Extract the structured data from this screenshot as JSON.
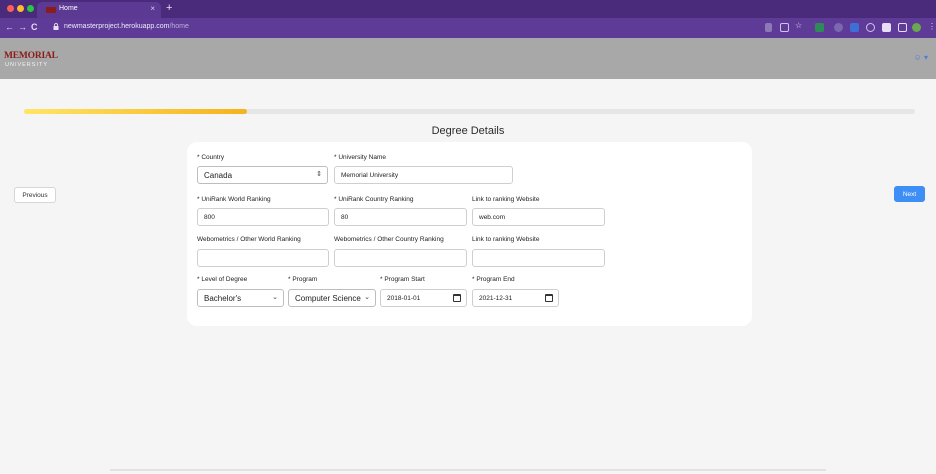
{
  "browser": {
    "tab_title": "Home",
    "tab_close": "×",
    "new_tab": "+",
    "url_host": "newmasterproject.herokuapp.com",
    "url_path": "/home",
    "nav": {
      "back": "←",
      "forward": "→",
      "reload": "C"
    }
  },
  "app": {
    "logo_word": "MEMORIAL",
    "logo_sub": "UNIVERSITY",
    "user_menu": "☺ ▾"
  },
  "progress": {
    "fraction": 0.25,
    "colors": [
      "#ffe566",
      "#f5b21c"
    ]
  },
  "page_title": "Degree Details",
  "nav_buttons": {
    "previous": "Previous",
    "next": "Next"
  },
  "form": {
    "country": {
      "label": "* Country",
      "value": "Canada"
    },
    "university_name": {
      "label": "* University Name",
      "value": "Memorial University"
    },
    "unirank_world": {
      "label": "* UniRank World Ranking",
      "value": "800"
    },
    "unirank_country": {
      "label": "* UniRank Country Ranking",
      "value": "80"
    },
    "link_ranking_1": {
      "label": "Link to ranking Website",
      "value": "web.com"
    },
    "webometrics_world": {
      "label": "Webometrics / Other World Ranking",
      "value": ""
    },
    "webometrics_country": {
      "label": "Webometrics / Other Country Ranking",
      "value": ""
    },
    "link_ranking_2": {
      "label": "Link to ranking Website",
      "value": ""
    },
    "level_of_degree": {
      "label": "* Level of Degree",
      "value": "Bachelor's"
    },
    "program": {
      "label": "* Program",
      "value": "Computer Science"
    },
    "program_start": {
      "label": "* Program Start",
      "value": "2018-01-01"
    },
    "program_end": {
      "label": "* Program End",
      "value": "2021-12-31"
    }
  },
  "colors": {
    "accent": "#3d8ef5",
    "brand": "#8b1a1a",
    "browser": "#4a2a7a"
  }
}
